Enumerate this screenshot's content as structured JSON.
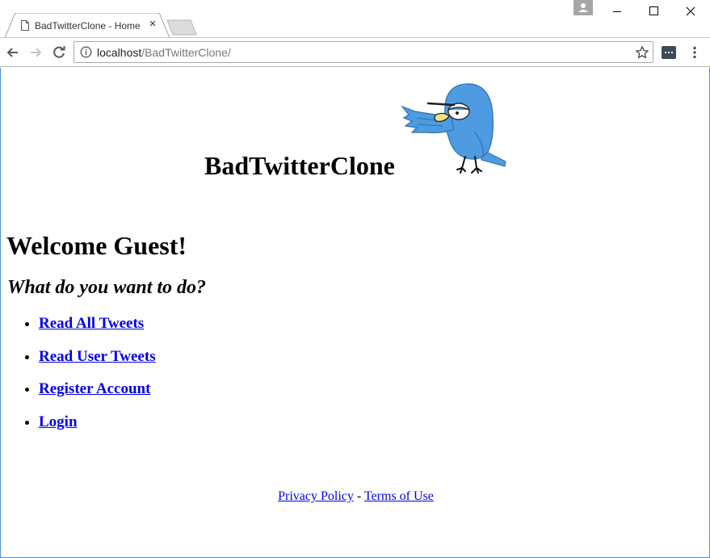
{
  "browser": {
    "tab_title": "BadTwitterClone - Home",
    "url_host": "localhost",
    "url_path": "/BadTwitterClone/"
  },
  "page": {
    "site_title": "BadTwitterClone",
    "welcome": "Welcome Guest!",
    "question": "What do you want to do?",
    "menu_items": [
      {
        "label": "Read All Tweets"
      },
      {
        "label": "Read User Tweets"
      },
      {
        "label": "Register Account"
      },
      {
        "label": "Login"
      }
    ],
    "footer": {
      "privacy": "Privacy Policy",
      "separator": " - ",
      "terms": "Terms of Use"
    }
  },
  "icons": {
    "page": "page-icon",
    "close": "close-icon",
    "back": "arrow-left-icon",
    "forward": "arrow-right-icon",
    "reload": "reload-icon",
    "info": "info-icon",
    "star": "star-icon",
    "extension": "extension-icon",
    "menu": "kebab-menu-icon",
    "bird": "grumpy-bird-logo"
  },
  "colors": {
    "link": "#0000ee",
    "bird_blue": "#4d9be0",
    "viewport_border": "#4a90d9"
  }
}
